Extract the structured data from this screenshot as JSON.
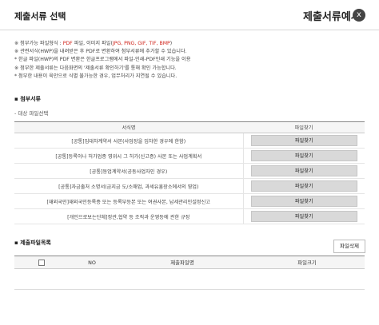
{
  "dialog": {
    "title": "제출서류 선택",
    "example_tag": "제출서류예시",
    "close_icon": "x"
  },
  "notes": [
    {
      "pre": "※ 첨부가능 파일형식 : ",
      "pdf": "PDF",
      "mid": " 파일, 이미지 파일(",
      "types": "JPG, PNG, GIF, TIF, BMP",
      "post": ")"
    },
    {
      "text": "※ 관련서식(HWP)을 내려받은 후 PDF로 변환하여 첨부서류에 추가할 수 있습니다."
    },
    {
      "text": "  * 한글 파일(HWP)의 PDF 변환은 한글프로그램에서 파일-인쇄-PDF인쇄 기능을 이용"
    },
    {
      "text": "※ 첨부한 제출서류는 다음화면의 '제출서류 확인하기'를 통해 확인 가능합니다."
    },
    {
      "text": "  * 첨부한 내용이 육안으로 식별 불가능한 경우, 업무처리가 지연될 수 있습니다."
    }
  ],
  "attachments": {
    "label": "첨부서류",
    "target_label": "- 대상 파일선택",
    "columns": [
      "서식명",
      "파일찾기"
    ],
    "rows": [
      {
        "name": "[공통]임대차계약서 사본(사업장을 임차한 경우에 한함)",
        "button": "파일찾기"
      },
      {
        "name": "[공통]등록이나 허가업종 영위시 그 허가(신고증) 사본 또는 사업계획서",
        "button": "파일찾기"
      },
      {
        "name": "[공통]동업계약서(공동사업자인 경우)",
        "button": "파일찾기"
      },
      {
        "name": "[공통]자금출처 소명서(금지금 도/소매업, 과세유흥장소에서의 영업)",
        "button": "파일찾기"
      },
      {
        "name": "[재외국민]재외국민등록증 또는 등록부등본 또는 여권사본, 납세관리인설정신고",
        "button": "파일찾기"
      },
      {
        "name": "[개인으로보는단체]정관,협약 등 조직과 운영등에 관한 규정",
        "button": "파일찾기"
      }
    ]
  },
  "submitted": {
    "label": "제출파일목록",
    "delete_button": "파일삭제",
    "columns": [
      "NO",
      "제출파일명",
      "파일크기"
    ]
  }
}
